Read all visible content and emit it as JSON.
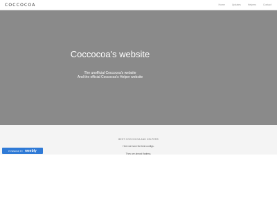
{
  "header": {
    "logo": "COCCOCOA",
    "nav": [
      {
        "label": "Home"
      },
      {
        "label": "Updates"
      },
      {
        "label": "Helpers"
      },
      {
        "label": "Contact"
      }
    ]
  },
  "hero": {
    "title": "Coccocoa's website",
    "line1": "The unofficial Coccocoa's website",
    "line2": "And the official Coccocoa's Helper website"
  },
  "section": {
    "heading": "BEST COCCOCOA AND HELPERS",
    "text1": "Here we have the best configs.",
    "text2": "They are almost flagless."
  },
  "badge": {
    "prefix": "POWERED BY",
    "brand": "weebly",
    "color": "#2f7ad6"
  }
}
